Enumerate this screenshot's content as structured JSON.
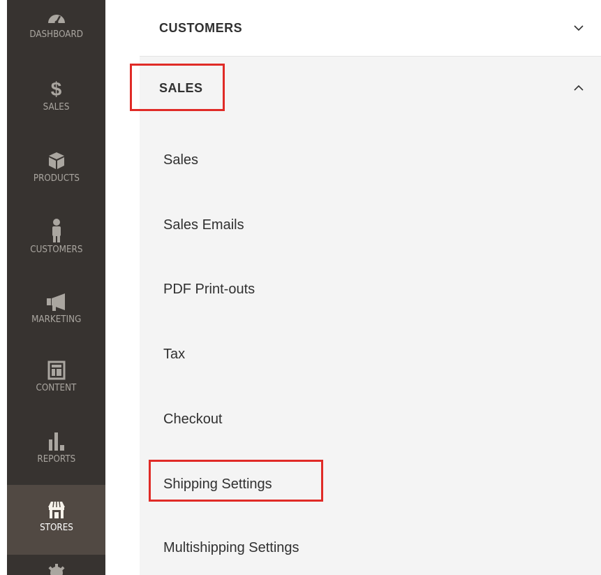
{
  "sidebar": {
    "items": [
      {
        "label": "DASHBOARD",
        "icon": "dashboard-icon"
      },
      {
        "label": "SALES",
        "icon": "dollar-icon"
      },
      {
        "label": "PRODUCTS",
        "icon": "box-icon"
      },
      {
        "label": "CUSTOMERS",
        "icon": "person-icon"
      },
      {
        "label": "MARKETING",
        "icon": "megaphone-icon"
      },
      {
        "label": "CONTENT",
        "icon": "layout-icon"
      },
      {
        "label": "REPORTS",
        "icon": "bar-chart-icon"
      },
      {
        "label": "STORES",
        "icon": "store-icon",
        "active": true
      }
    ]
  },
  "panel": {
    "customers_header": "CUSTOMERS",
    "sales_header": "SALES",
    "sales_items": [
      "Sales",
      "Sales Emails",
      "PDF Print-outs",
      "Tax",
      "Checkout",
      "Shipping Settings",
      "Multishipping Settings"
    ]
  },
  "colors": {
    "sidebar_bg": "#373330",
    "sidebar_active_bg": "#514943",
    "highlight_red": "#e02b27",
    "panel_bg": "#f4f4f4"
  }
}
